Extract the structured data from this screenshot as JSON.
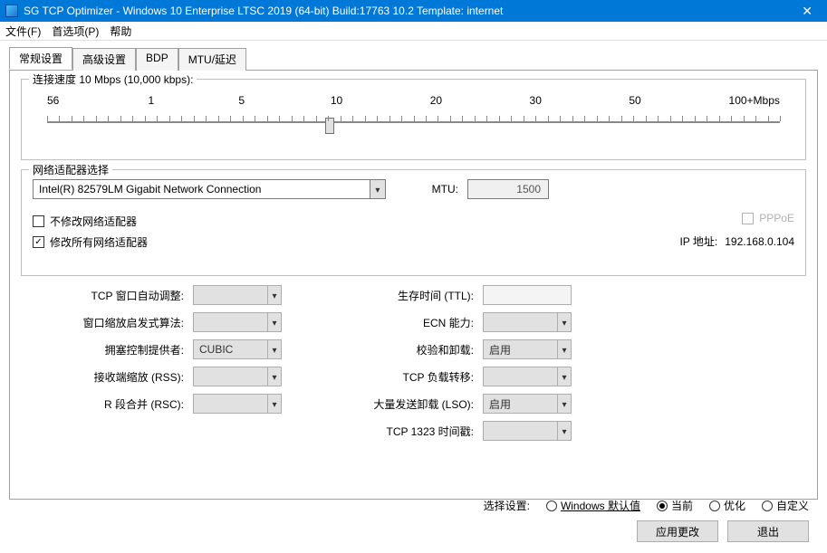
{
  "title": "SG TCP Optimizer - Windows 10 Enterprise LTSC 2019 (64-bit) Build:17763 10.2  Template: internet",
  "menu": {
    "file": "文件(F)",
    "prefs": "首选项(P)",
    "help": "帮助"
  },
  "tabs": {
    "general": "常规设置",
    "advanced": "高级设置",
    "bdp": "BDP",
    "mtu": "MTU/延迟"
  },
  "speed": {
    "group_title": "连接速度 10 Mbps (10,000 kbps):",
    "ticks": [
      "56",
      "1",
      "5",
      "10",
      "20",
      "30",
      "50",
      "100+Mbps"
    ]
  },
  "adapter": {
    "group_title": "网络适配器选择",
    "selected": "Intel(R) 82579LM Gigabit Network Connection",
    "mtu_label": "MTU:",
    "mtu_value": "1500",
    "no_modify": "不修改网络适配器",
    "modify_all": "修改所有网络适配器",
    "pppoe": "PPPoE",
    "ip_label": "IP 地址:",
    "ip_value": "192.168.0.104"
  },
  "settings": {
    "tcp_auto": "TCP 窗口自动调整:",
    "heuristic": "窗口缩放启发式算法:",
    "congestion": "拥塞控制提供者:",
    "congestion_val": "CUBIC",
    "rss": "接收端缩放 (RSS):",
    "rsc": "R 段合并 (RSC):",
    "ttl": "生存时间 (TTL):",
    "ecn": "ECN 能力:",
    "chksum": "校验和卸载:",
    "chksum_val": "启用",
    "chimney": "TCP 负载转移:",
    "lso": "大量发送卸载 (LSO):",
    "lso_val": "启用",
    "ts1323": "TCP 1323 时间戳:"
  },
  "footer": {
    "select_label": "选择设置:",
    "opt_default": "Windows 默认值",
    "opt_current": "当前",
    "opt_optimal": "优化",
    "opt_custom": "自定义",
    "apply": "应用更改",
    "exit": "退出"
  }
}
